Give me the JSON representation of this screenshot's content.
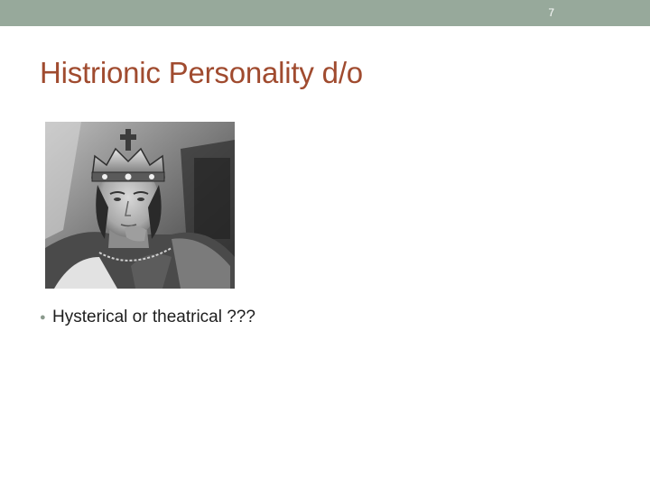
{
  "slide": {
    "number": "7",
    "title": "Histrionic Personality d/o",
    "bullets": [
      "Hysterical or theatrical ???"
    ]
  },
  "icons": {
    "bullet": "bullet-dot-icon",
    "photo": "crowned-man-photo"
  },
  "colors": {
    "top_bar": "#97a99b",
    "title": "#a04b2f",
    "body_text": "#1e1e1e",
    "bullet": "#8b9a8d"
  }
}
